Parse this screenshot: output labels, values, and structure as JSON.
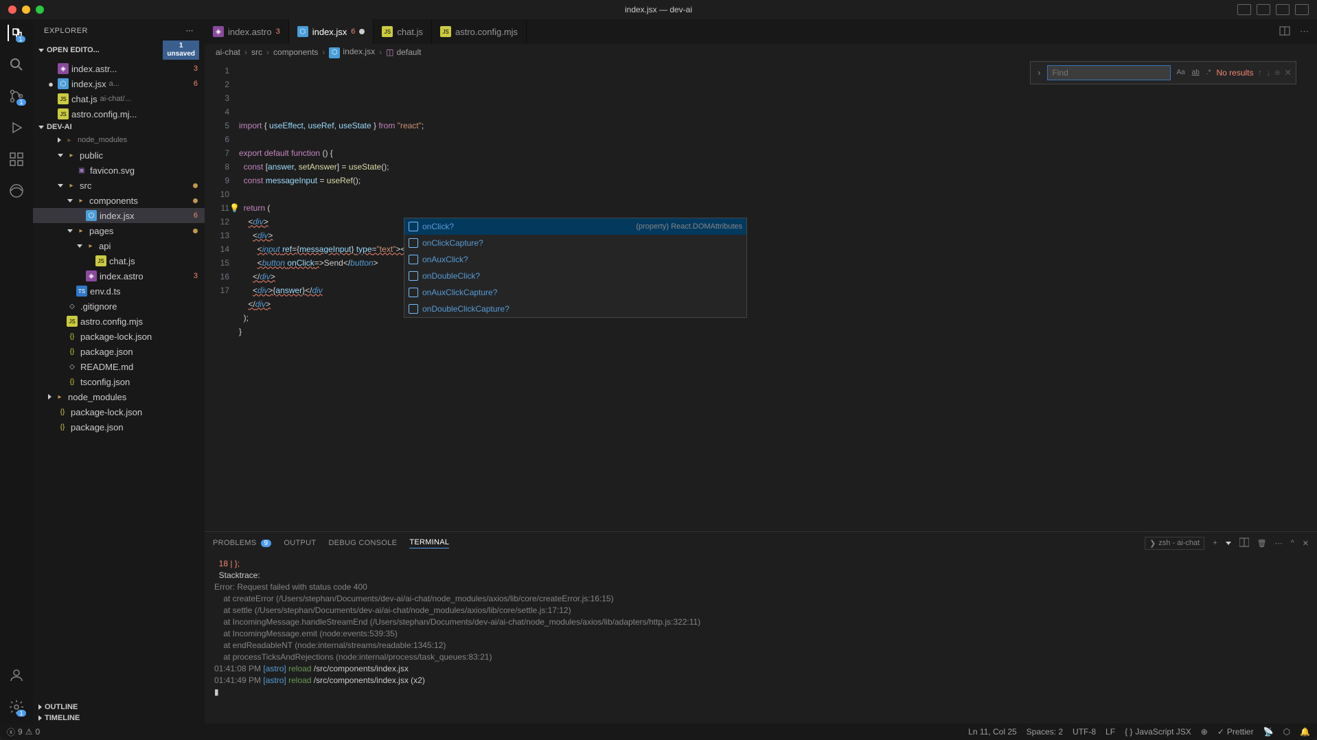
{
  "window": {
    "title": "index.jsx — dev-ai"
  },
  "activity": {
    "explorer_badge": "1",
    "scm_badge": "1",
    "settings_badge": "1"
  },
  "explorer": {
    "title": "EXPLORER",
    "unsaved": "1\nunsaved",
    "openEditors": {
      "label": "OPEN EDITO...",
      "items": [
        {
          "name": "index.astr...",
          "errors": "3",
          "icon": "astro"
        },
        {
          "name": "index.jsx",
          "hint": "a...",
          "errors": "6",
          "icon": "jsx",
          "dirty": true
        },
        {
          "name": "chat.js",
          "hint": "ai-chat/...",
          "icon": "js"
        },
        {
          "name": "astro.config.mj...",
          "icon": "js"
        }
      ]
    },
    "project": {
      "label": "DEV-AI",
      "tree": [
        {
          "name": "node_modules",
          "type": "folder-dim",
          "depth": 2
        },
        {
          "name": "public",
          "type": "folder",
          "depth": 2,
          "open": true
        },
        {
          "name": "favicon.svg",
          "type": "svg",
          "depth": 3
        },
        {
          "name": "src",
          "type": "folder",
          "depth": 2,
          "open": true,
          "mod": true
        },
        {
          "name": "components",
          "type": "folder",
          "depth": 3,
          "open": true,
          "mod": true
        },
        {
          "name": "index.jsx",
          "type": "jsx",
          "depth": 4,
          "errors": "6",
          "active": true
        },
        {
          "name": "pages",
          "type": "folder",
          "depth": 3,
          "open": true,
          "mod": true
        },
        {
          "name": "api",
          "type": "folder",
          "depth": 4,
          "open": true
        },
        {
          "name": "chat.js",
          "type": "js",
          "depth": 5
        },
        {
          "name": "index.astro",
          "type": "astro",
          "depth": 4,
          "errors": "3"
        },
        {
          "name": "env.d.ts",
          "type": "ts",
          "depth": 3
        },
        {
          "name": ".gitignore",
          "type": "file",
          "depth": 2
        },
        {
          "name": "astro.config.mjs",
          "type": "js",
          "depth": 2
        },
        {
          "name": "package-lock.json",
          "type": "json",
          "depth": 2
        },
        {
          "name": "package.json",
          "type": "json",
          "depth": 2
        },
        {
          "name": "README.md",
          "type": "file",
          "depth": 2
        },
        {
          "name": "tsconfig.json",
          "type": "json",
          "depth": 2
        },
        {
          "name": "node_modules",
          "type": "folder",
          "depth": 1
        },
        {
          "name": "package-lock.json",
          "type": "json",
          "depth": 1
        },
        {
          "name": "package.json",
          "type": "json",
          "depth": 1
        }
      ]
    },
    "outline": "OUTLINE",
    "timeline": "TIMELINE"
  },
  "tabs": [
    {
      "label": "index.astro",
      "icon": "astro",
      "badge": "3"
    },
    {
      "label": "index.jsx",
      "icon": "jsx",
      "badge": "6",
      "active": true,
      "dirty": true
    },
    {
      "label": "chat.js",
      "icon": "js"
    },
    {
      "label": "astro.config.mjs",
      "icon": "js"
    }
  ],
  "breadcrumb": [
    "ai-chat",
    "src",
    "components",
    "index.jsx",
    "default"
  ],
  "find": {
    "placeholder": "Find",
    "results": "No results"
  },
  "code_lines": 17,
  "suggest": {
    "items": [
      {
        "label": "onClick?",
        "detail": "(property) React.DOMAttributes<HTMLButtonEle…",
        "selected": true
      },
      {
        "label": "onClickCapture?"
      },
      {
        "label": "onAuxClick?"
      },
      {
        "label": "onDoubleClick?"
      },
      {
        "label": "onAuxClickCapture?"
      },
      {
        "label": "onDoubleClickCapture?"
      }
    ]
  },
  "panel": {
    "tabs": {
      "problems": "PROBLEMS",
      "problems_badge": "9",
      "output": "OUTPUT",
      "debug": "DEBUG CONSOLE",
      "terminal": "TERMINAL"
    },
    "term_selector": "zsh - ai-chat",
    "terminal_lines": [
      {
        "segs": [
          {
            "t": "  18 | };",
            "c": "t-red"
          }
        ]
      },
      {
        "segs": [
          {
            "t": "  Stacktrace:",
            "c": ""
          }
        ]
      },
      {
        "segs": [
          {
            "t": "Error: Request failed with status code 400",
            "c": "t-dim"
          }
        ]
      },
      {
        "segs": [
          {
            "t": "    at createError (/Users/stephan/Documents/dev-ai/ai-chat/node_modules/axios/lib/core/createError.js:16:15)",
            "c": "t-dim"
          }
        ]
      },
      {
        "segs": [
          {
            "t": "    at settle (/Users/stephan/Documents/dev-ai/ai-chat/node_modules/axios/lib/core/settle.js:17:12)",
            "c": "t-dim"
          }
        ]
      },
      {
        "segs": [
          {
            "t": "    at IncomingMessage.handleStreamEnd (/Users/stephan/Documents/dev-ai/ai-chat/node_modules/axios/lib/adapters/http.js:322:11)",
            "c": "t-dim"
          }
        ]
      },
      {
        "segs": [
          {
            "t": "    at IncomingMessage.emit (node:events:539:35)",
            "c": "t-dim"
          }
        ]
      },
      {
        "segs": [
          {
            "t": "    at endReadableNT (node:internal/streams/readable:1345:12)",
            "c": "t-dim"
          }
        ]
      },
      {
        "segs": [
          {
            "t": "    at processTicksAndRejections (node:internal/process/task_queues:83:21)",
            "c": "t-dim"
          }
        ]
      },
      {
        "segs": [
          {
            "t": "",
            "c": ""
          }
        ]
      },
      {
        "segs": [
          {
            "t": "01:41:08 PM ",
            "c": "t-dim"
          },
          {
            "t": "[astro]",
            "c": "t-blue"
          },
          {
            "t": " reload",
            "c": "t-green"
          },
          {
            "t": " /src/components/index.jsx",
            "c": ""
          }
        ]
      },
      {
        "segs": [
          {
            "t": "01:41:49 PM ",
            "c": "t-dim"
          },
          {
            "t": "[astro]",
            "c": "t-blue"
          },
          {
            "t": " reload",
            "c": "t-green"
          },
          {
            "t": " /src/components/index.jsx (x2)",
            "c": ""
          }
        ]
      },
      {
        "segs": [
          {
            "t": "▮",
            "c": ""
          }
        ]
      }
    ]
  },
  "status": {
    "errors": "9",
    "warnings": "0",
    "pos": "Ln 11, Col 25",
    "spaces": "Spaces: 2",
    "encoding": "UTF-8",
    "eol": "LF",
    "lang": "JavaScript JSX",
    "prettier": "Prettier"
  }
}
